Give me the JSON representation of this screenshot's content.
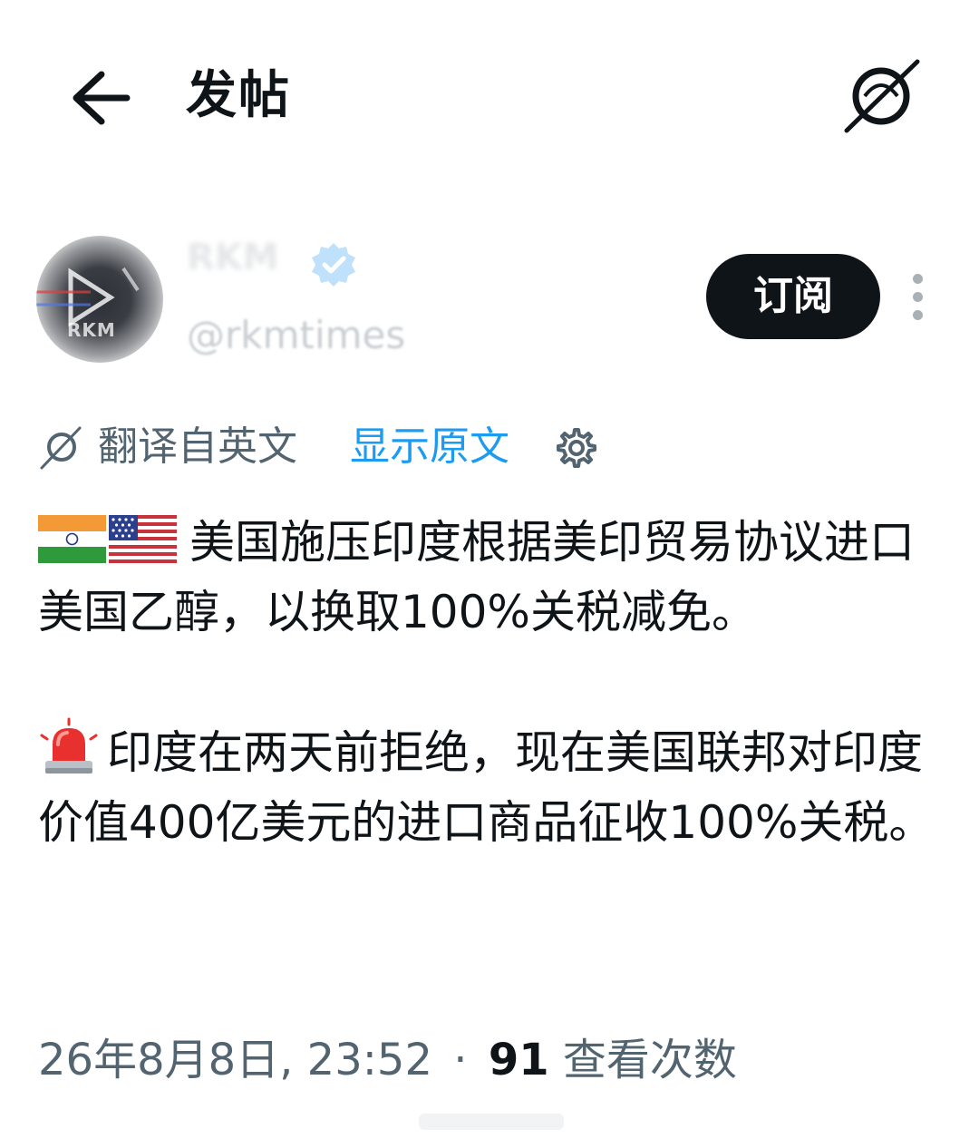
{
  "header": {
    "title": "发帖",
    "back_icon": "arrow-left-icon",
    "translate_icon": "translate-icon"
  },
  "author": {
    "display_name": "RKM",
    "handle": "@rkmtimes",
    "avatar_text": "RKM",
    "verified_icon": "verified-badge-icon",
    "subscribe_label": "订阅",
    "more_icon": "more-vertical-icon"
  },
  "translation": {
    "label": "翻译自英文",
    "show_original": "显示原文",
    "icon": "translate-icon",
    "settings_icon": "gear-icon"
  },
  "post": {
    "paragraph_1": {
      "emoji": [
        "🇮🇳",
        "🇺🇸"
      ],
      "text": "美国施压印度根据美印贸易协议进口美国乙醇，以换取100%关税减免。"
    },
    "paragraph_2": {
      "emoji": "🚨",
      "text": "印度在两天前拒绝，现在美国联邦对印度价值400亿美元的进口商品征收100%关税。"
    }
  },
  "meta": {
    "timestamp": "26年8月8日, 23:52",
    "separator": "·",
    "views_count": "91",
    "views_label": "查看次数"
  },
  "colors": {
    "text_primary": "#0f1419",
    "text_secondary": "#536471",
    "link": "#1d9bf0",
    "button_bg": "#0f1419",
    "verified": "#1d9bf0"
  }
}
